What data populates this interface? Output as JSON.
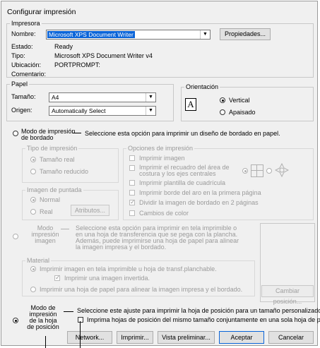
{
  "dialog": {
    "title": "Configurar impresión"
  },
  "printer": {
    "legend": "Impresora",
    "name_label": "Nombre:",
    "name_value": "Microsoft XPS Document Writer",
    "properties_button": "Propiedades...",
    "status_label": "Estado:",
    "status_value": "Ready",
    "type_label": "Tipo:",
    "type_value": "Microsoft XPS Document Writer v4",
    "location_label": "Ubicación:",
    "location_value": "PORTPROMPT:",
    "comment_label": "Comentario:"
  },
  "paper": {
    "legend": "Papel",
    "size_label": "Tamaño:",
    "size_value": "A4",
    "source_label": "Origen:",
    "source_value": "Automatically Select"
  },
  "orientation": {
    "legend": "Orientación",
    "vertical": "Vertical",
    "landscape": "Apaisado"
  },
  "embroidery": {
    "radio_label": "Modo de impresión\nde bordado",
    "description": "Seleccione esta opción para imprimir un diseño de bordado en papel.",
    "print_type": {
      "legend": "Tipo de impresión",
      "real": "Tamaño real",
      "reduced": "Tamaño reducido"
    },
    "options": {
      "legend": "Opciones de impresión",
      "print_image": "Imprimir imagen",
      "print_frame": "Imprimir el recuadro del área de costura y los ejes centrales",
      "print_grid": "Imprimir plantilla de cuadrícula",
      "print_hoop": "Imprimir borde del aro en la primera página",
      "split_pages": "Dividir la imagen de bordado en 2 páginas",
      "color_changes": "Cambios de color"
    },
    "stitch_image": {
      "legend": "Imagen de puntada",
      "normal": "Normal",
      "real": "Real",
      "attributes_button": "Atributos..."
    }
  },
  "image_mode": {
    "radio_label": "Modo\nimpresión\nimagen",
    "description": "Seleccione esta opción para imprimir en tela imprimible o en una hoja de transferencia que se pega con la plancha. Además, puede imprimirse una hoja de papel para alinear la imagen impresa y el bordado.",
    "material": {
      "legend": "Material",
      "option1": "Imprimir imagen en tela imprimible u hoja de transf.planchable.",
      "invert": "Imprimir una imagen invertida.",
      "option2": "Imprimir una hoja de papel para alinear la imagen impresa y el bordado."
    },
    "change_position_button": "Cambiar posición..."
  },
  "position_mode": {
    "radio_label": "Modo de\nimpresión\nde la hoja\nde posición",
    "description": "Seleccione este ajuste para imprimir la hoja de posición para un tamaño personalizado.",
    "same_size_checkbox": "Imprima hojas de posición del mismo tamaño conjuntamente en una sola hoja de papel."
  },
  "footer": {
    "network": "Network...",
    "print": "Imprimir...",
    "preview": "Vista preliminar...",
    "accept": "Aceptar",
    "cancel": "Cancelar"
  }
}
